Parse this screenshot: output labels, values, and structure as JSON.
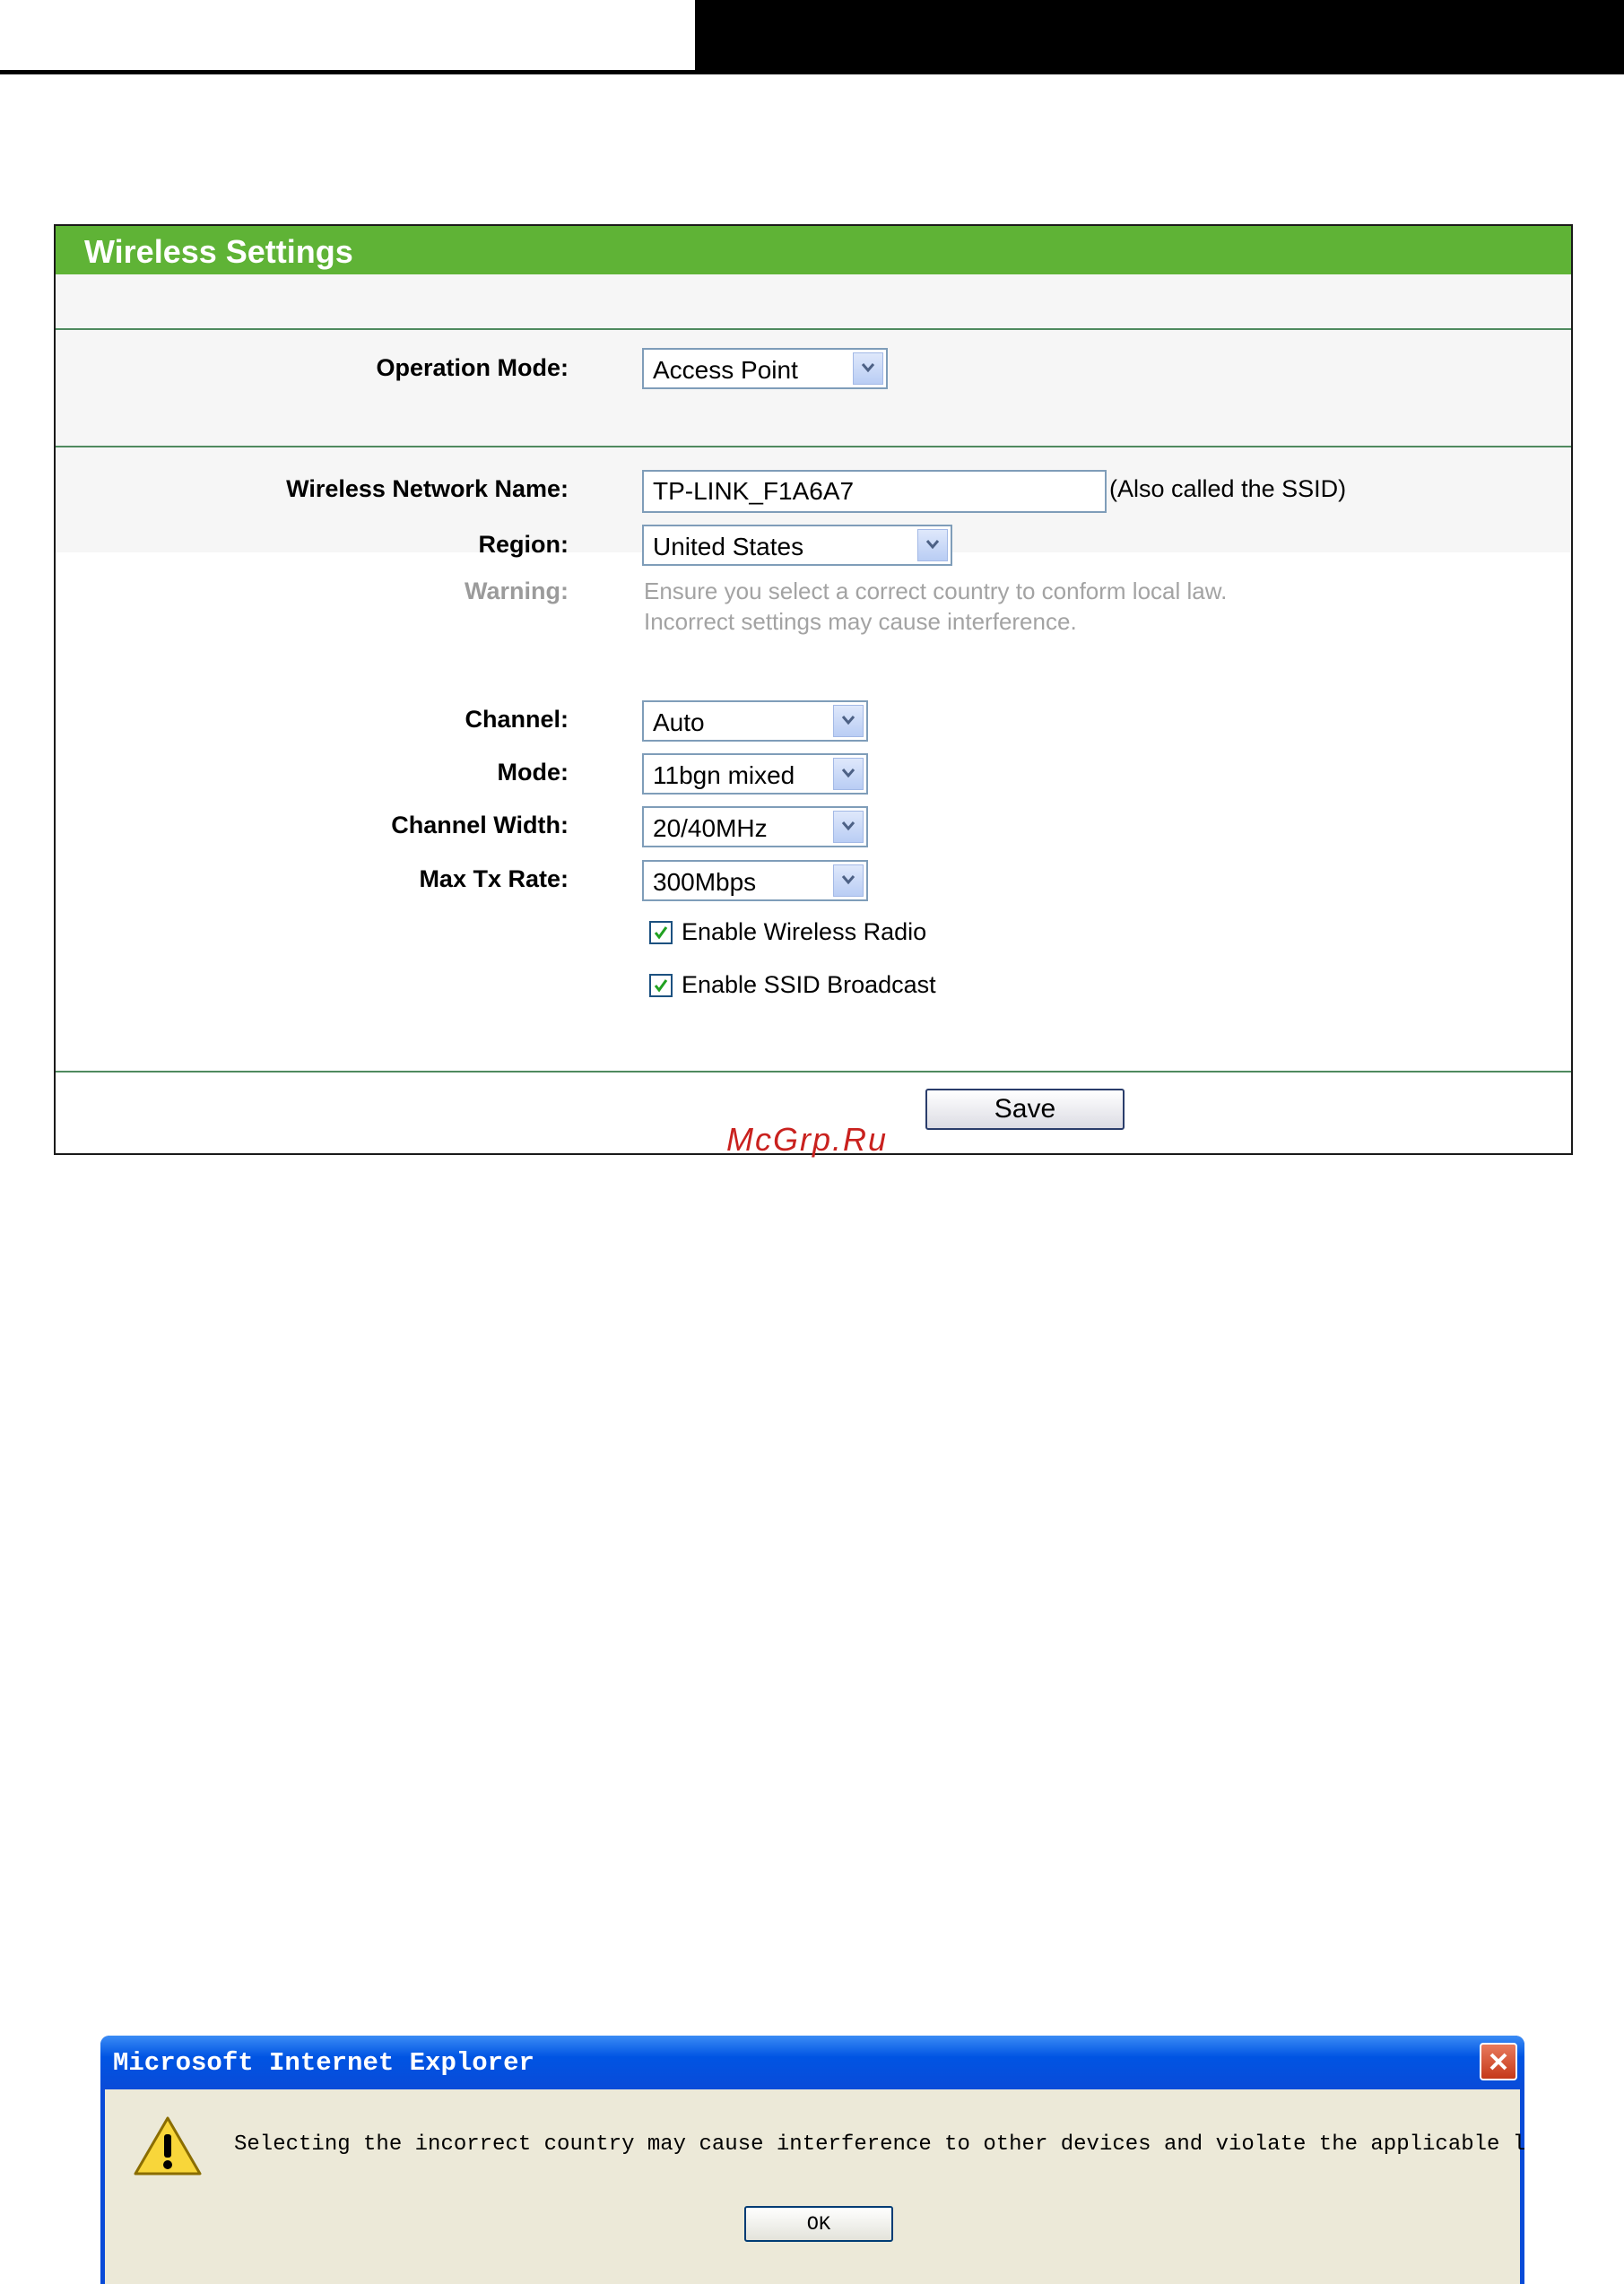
{
  "panel": {
    "title": "Wireless Settings",
    "operation_mode": {
      "label": "Operation Mode:",
      "value": "Access Point"
    },
    "ssid": {
      "label": "Wireless Network Name:",
      "value": "TP-LINK_F1A6A7",
      "note": "(Also called the SSID)"
    },
    "region": {
      "label": "Region:",
      "value": "United States"
    },
    "warning": {
      "label": "Warning:",
      "line1": "Ensure you select a correct country to conform local law.",
      "line2": "Incorrect settings may cause interference."
    },
    "channel": {
      "label": "Channel:",
      "value": "Auto"
    },
    "mode": {
      "label": "Mode:",
      "value": "11bgn mixed"
    },
    "channel_width": {
      "label": "Channel Width:",
      "value": "20/40MHz"
    },
    "max_tx_rate": {
      "label": "Max Tx Rate:",
      "value": "300Mbps"
    },
    "enable_radio": {
      "label": "Enable Wireless Radio",
      "checked": true
    },
    "enable_ssid_broadcast": {
      "label": "Enable SSID Broadcast",
      "checked": true
    },
    "save_label": "Save"
  },
  "watermark": "McGrp.Ru",
  "dialog": {
    "title": "Microsoft Internet Explorer",
    "message": "Selecting the incorrect country may cause interference to other devices and violate the applicable law.",
    "ok_label": "OK"
  },
  "colors": {
    "header_green": "#5fb336",
    "xp_blue": "#0a4bd8",
    "dialog_bg": "#ece9d8"
  }
}
